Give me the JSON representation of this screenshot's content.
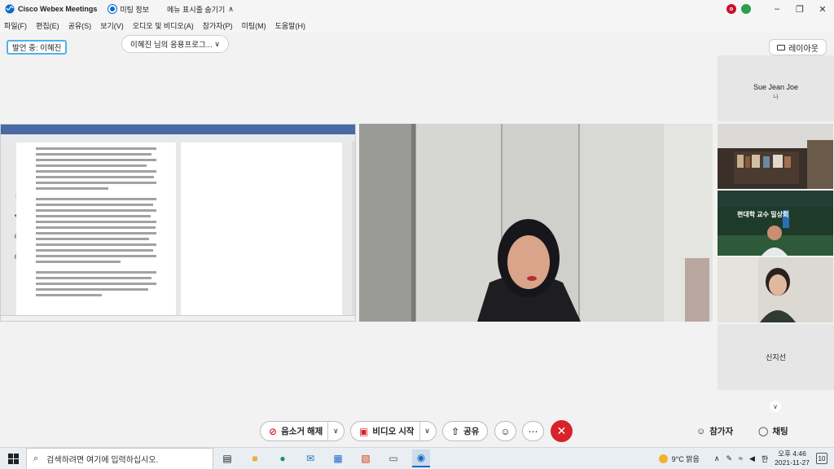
{
  "titlebar": {
    "app_title": "Cisco Webex Meetings",
    "meeting_info": "미팅 정보",
    "hide_menu": "메뉴 표시줄 숨기기",
    "badge_initial": "o"
  },
  "menu": {
    "items": [
      "파일(F)",
      "편집(E)",
      "공유(S)",
      "보기(V)",
      "오디오 및 비디오(A)",
      "참가자(P)",
      "미팅(M)",
      "도움말(H)"
    ]
  },
  "speaker": {
    "label": "발언 중: 이혜진"
  },
  "share_selector": {
    "label": "이혜진 님의 응용프로그..."
  },
  "layout_button": {
    "label": "레이아웃"
  },
  "participants": {
    "self_name": "Sue Jean Joe",
    "self_tag": "나",
    "thumb3_text": "편대학 교수  밀상회",
    "bottom_name": "신지선"
  },
  "controls": {
    "mute": "음소거 해제",
    "video": "비디오 시작",
    "share": "공유",
    "participants": "참가자",
    "chat": "채팅"
  },
  "taskbar": {
    "search_placeholder": "검색하려면 여기에 입력하십시오.",
    "weather": "9°C 맑음",
    "ime": "한",
    "time": "오후 4:46",
    "date": "2021-11-27",
    "notification_count": "10"
  },
  "colors": {
    "accent_blue": "#4fb3e8",
    "end_red": "#d8232a",
    "webex_blue": "#0b6bcb"
  }
}
